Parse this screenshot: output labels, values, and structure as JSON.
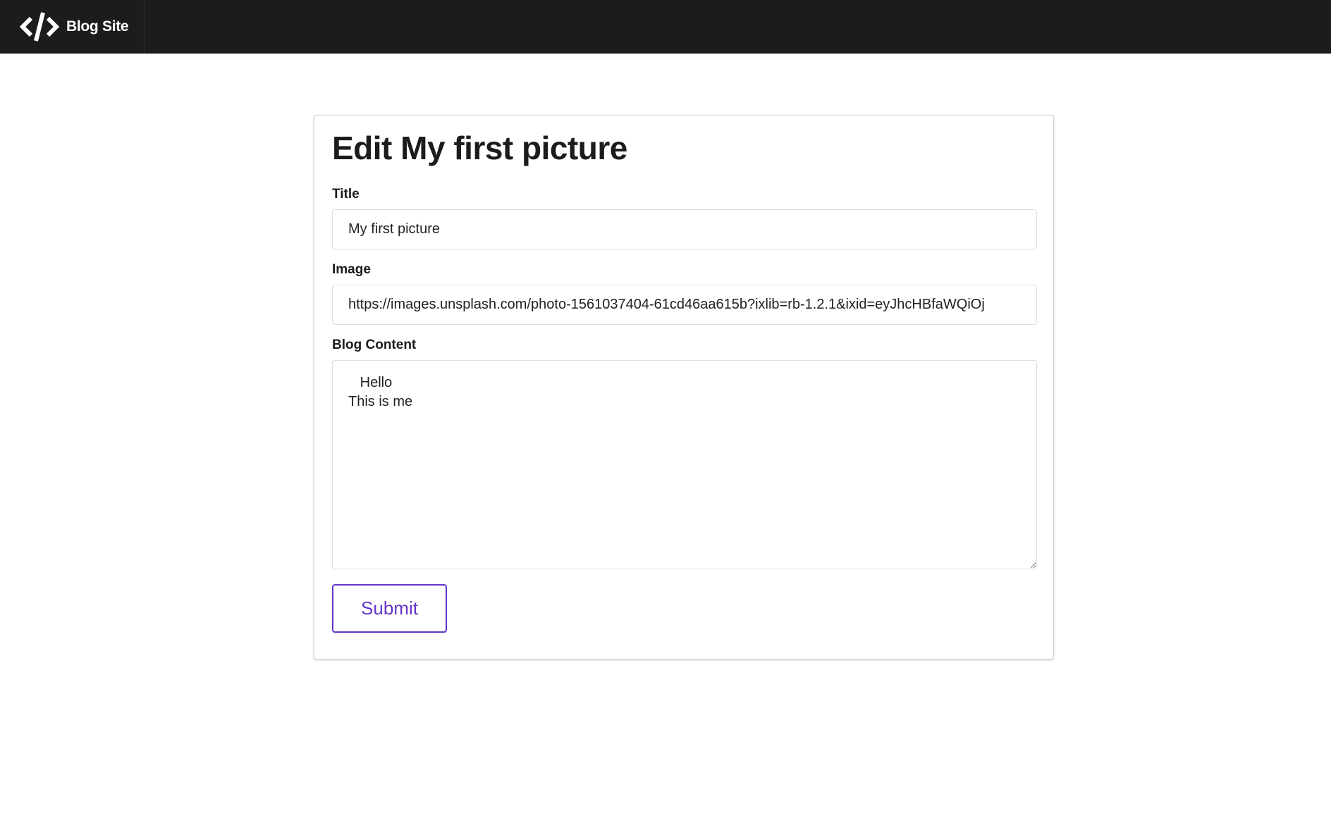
{
  "navbar": {
    "brand_icon": "code-icon",
    "brand_name": "Blog Site",
    "background": "#1b1c1d"
  },
  "form": {
    "heading": "Edit My first picture",
    "title_label": "Title",
    "title_value": "My first picture",
    "image_label": "Image",
    "image_value": "https://images.unsplash.com/photo-1561037404-61cd46aa615b?ixlib=rb-1.2.1&ixid=eyJhcHBfaWQiOj",
    "content_label": "Blog Content",
    "content_value": "   Hello\nThis is me",
    "submit_label": "Submit",
    "accent_color": "#6435c9"
  }
}
